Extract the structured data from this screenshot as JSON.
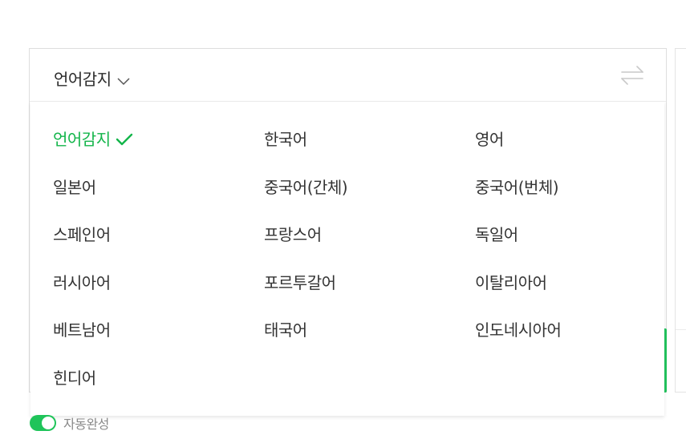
{
  "header": {
    "source_language": "언어감지",
    "source_chevron_icon": "chevron-down-icon",
    "swap_icon": "swap-arrows-icon"
  },
  "dropdown": {
    "selected": "언어감지",
    "check_icon": "check-icon",
    "accent_color": "#13b54a",
    "languages": [
      "언어감지",
      "한국어",
      "영어",
      "일본어",
      "중국어(간체)",
      "중국어(번체)",
      "스페인어",
      "프랑스어",
      "독일어",
      "러시아어",
      "포르투갈어",
      "이탈리아어",
      "베트남어",
      "태국어",
      "인도네시아어",
      "힌디어"
    ]
  },
  "footer": {
    "autocomplete_label": "자동완성",
    "autocomplete_enabled": true,
    "toggle_color": "#1fc45a"
  }
}
